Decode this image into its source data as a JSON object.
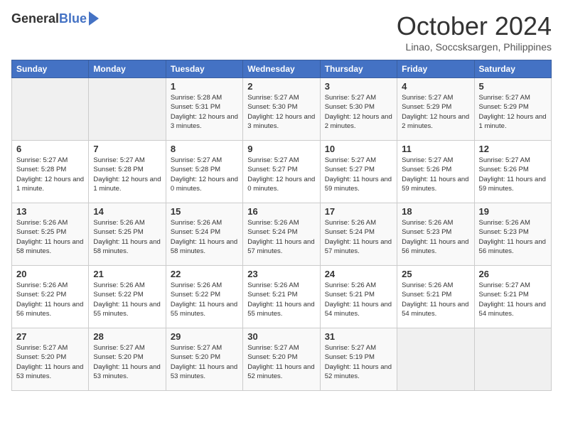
{
  "header": {
    "logo": {
      "general": "General",
      "blue": "Blue"
    },
    "title": "October 2024",
    "location": "Linao, Soccsksargen, Philippines"
  },
  "columns": [
    "Sunday",
    "Monday",
    "Tuesday",
    "Wednesday",
    "Thursday",
    "Friday",
    "Saturday"
  ],
  "weeks": [
    [
      {
        "day": "",
        "info": ""
      },
      {
        "day": "",
        "info": ""
      },
      {
        "day": "1",
        "sunrise": "Sunrise: 5:28 AM",
        "sunset": "Sunset: 5:31 PM",
        "daylight": "Daylight: 12 hours and 3 minutes."
      },
      {
        "day": "2",
        "sunrise": "Sunrise: 5:27 AM",
        "sunset": "Sunset: 5:30 PM",
        "daylight": "Daylight: 12 hours and 3 minutes."
      },
      {
        "day": "3",
        "sunrise": "Sunrise: 5:27 AM",
        "sunset": "Sunset: 5:30 PM",
        "daylight": "Daylight: 12 hours and 2 minutes."
      },
      {
        "day": "4",
        "sunrise": "Sunrise: 5:27 AM",
        "sunset": "Sunset: 5:29 PM",
        "daylight": "Daylight: 12 hours and 2 minutes."
      },
      {
        "day": "5",
        "sunrise": "Sunrise: 5:27 AM",
        "sunset": "Sunset: 5:29 PM",
        "daylight": "Daylight: 12 hours and 1 minute."
      }
    ],
    [
      {
        "day": "6",
        "sunrise": "Sunrise: 5:27 AM",
        "sunset": "Sunset: 5:28 PM",
        "daylight": "Daylight: 12 hours and 1 minute."
      },
      {
        "day": "7",
        "sunrise": "Sunrise: 5:27 AM",
        "sunset": "Sunset: 5:28 PM",
        "daylight": "Daylight: 12 hours and 1 minute."
      },
      {
        "day": "8",
        "sunrise": "Sunrise: 5:27 AM",
        "sunset": "Sunset: 5:28 PM",
        "daylight": "Daylight: 12 hours and 0 minutes."
      },
      {
        "day": "9",
        "sunrise": "Sunrise: 5:27 AM",
        "sunset": "Sunset: 5:27 PM",
        "daylight": "Daylight: 12 hours and 0 minutes."
      },
      {
        "day": "10",
        "sunrise": "Sunrise: 5:27 AM",
        "sunset": "Sunset: 5:27 PM",
        "daylight": "Daylight: 11 hours and 59 minutes."
      },
      {
        "day": "11",
        "sunrise": "Sunrise: 5:27 AM",
        "sunset": "Sunset: 5:26 PM",
        "daylight": "Daylight: 11 hours and 59 minutes."
      },
      {
        "day": "12",
        "sunrise": "Sunrise: 5:27 AM",
        "sunset": "Sunset: 5:26 PM",
        "daylight": "Daylight: 11 hours and 59 minutes."
      }
    ],
    [
      {
        "day": "13",
        "sunrise": "Sunrise: 5:26 AM",
        "sunset": "Sunset: 5:25 PM",
        "daylight": "Daylight: 11 hours and 58 minutes."
      },
      {
        "day": "14",
        "sunrise": "Sunrise: 5:26 AM",
        "sunset": "Sunset: 5:25 PM",
        "daylight": "Daylight: 11 hours and 58 minutes."
      },
      {
        "day": "15",
        "sunrise": "Sunrise: 5:26 AM",
        "sunset": "Sunset: 5:24 PM",
        "daylight": "Daylight: 11 hours and 58 minutes."
      },
      {
        "day": "16",
        "sunrise": "Sunrise: 5:26 AM",
        "sunset": "Sunset: 5:24 PM",
        "daylight": "Daylight: 11 hours and 57 minutes."
      },
      {
        "day": "17",
        "sunrise": "Sunrise: 5:26 AM",
        "sunset": "Sunset: 5:24 PM",
        "daylight": "Daylight: 11 hours and 57 minutes."
      },
      {
        "day": "18",
        "sunrise": "Sunrise: 5:26 AM",
        "sunset": "Sunset: 5:23 PM",
        "daylight": "Daylight: 11 hours and 56 minutes."
      },
      {
        "day": "19",
        "sunrise": "Sunrise: 5:26 AM",
        "sunset": "Sunset: 5:23 PM",
        "daylight": "Daylight: 11 hours and 56 minutes."
      }
    ],
    [
      {
        "day": "20",
        "sunrise": "Sunrise: 5:26 AM",
        "sunset": "Sunset: 5:22 PM",
        "daylight": "Daylight: 11 hours and 56 minutes."
      },
      {
        "day": "21",
        "sunrise": "Sunrise: 5:26 AM",
        "sunset": "Sunset: 5:22 PM",
        "daylight": "Daylight: 11 hours and 55 minutes."
      },
      {
        "day": "22",
        "sunrise": "Sunrise: 5:26 AM",
        "sunset": "Sunset: 5:22 PM",
        "daylight": "Daylight: 11 hours and 55 minutes."
      },
      {
        "day": "23",
        "sunrise": "Sunrise: 5:26 AM",
        "sunset": "Sunset: 5:21 PM",
        "daylight": "Daylight: 11 hours and 55 minutes."
      },
      {
        "day": "24",
        "sunrise": "Sunrise: 5:26 AM",
        "sunset": "Sunset: 5:21 PM",
        "daylight": "Daylight: 11 hours and 54 minutes."
      },
      {
        "day": "25",
        "sunrise": "Sunrise: 5:26 AM",
        "sunset": "Sunset: 5:21 PM",
        "daylight": "Daylight: 11 hours and 54 minutes."
      },
      {
        "day": "26",
        "sunrise": "Sunrise: 5:27 AM",
        "sunset": "Sunset: 5:21 PM",
        "daylight": "Daylight: 11 hours and 54 minutes."
      }
    ],
    [
      {
        "day": "27",
        "sunrise": "Sunrise: 5:27 AM",
        "sunset": "Sunset: 5:20 PM",
        "daylight": "Daylight: 11 hours and 53 minutes."
      },
      {
        "day": "28",
        "sunrise": "Sunrise: 5:27 AM",
        "sunset": "Sunset: 5:20 PM",
        "daylight": "Daylight: 11 hours and 53 minutes."
      },
      {
        "day": "29",
        "sunrise": "Sunrise: 5:27 AM",
        "sunset": "Sunset: 5:20 PM",
        "daylight": "Daylight: 11 hours and 53 minutes."
      },
      {
        "day": "30",
        "sunrise": "Sunrise: 5:27 AM",
        "sunset": "Sunset: 5:20 PM",
        "daylight": "Daylight: 11 hours and 52 minutes."
      },
      {
        "day": "31",
        "sunrise": "Sunrise: 5:27 AM",
        "sunset": "Sunset: 5:19 PM",
        "daylight": "Daylight: 11 hours and 52 minutes."
      },
      {
        "day": "",
        "info": ""
      },
      {
        "day": "",
        "info": ""
      }
    ]
  ]
}
